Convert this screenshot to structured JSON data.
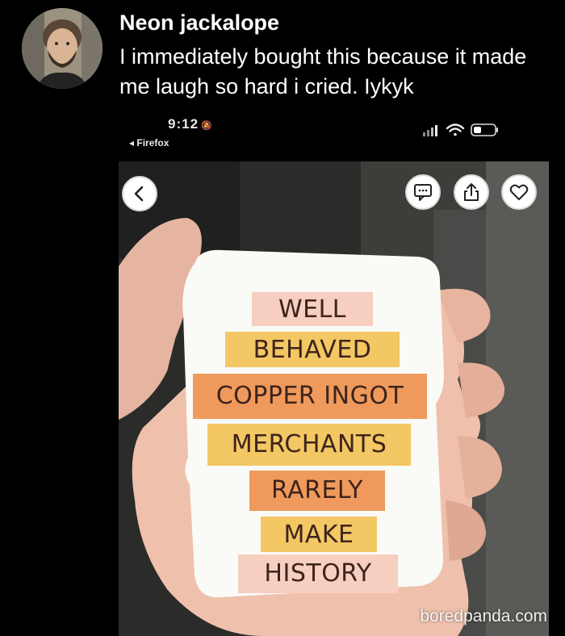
{
  "post": {
    "author_name": "Neon jackalope",
    "text": "I immediately bought this because it made me laugh so hard i cried. Iykyk"
  },
  "embedded": {
    "status_time": "9:12",
    "back_app_label": "◂ Firefox",
    "sticker_lines": [
      "WELL",
      "BEHAVED",
      "COPPER INGOT",
      "MERCHANTS",
      "RARELY",
      "MAKE",
      "HISTORY"
    ]
  },
  "watermark": "boredpanda.com",
  "colors": {
    "background": "#000000",
    "sticker_band_pink": "#f6cfc0",
    "sticker_band_yellow": "#f3c763",
    "sticker_band_orange": "#ef9a5c",
    "sticker_text": "#3e241b"
  },
  "icons": [
    "avatar",
    "bell-muted-icon",
    "signal-icon",
    "wifi-icon",
    "battery-icon",
    "back-chevron-icon",
    "comment-icon",
    "share-icon",
    "heart-icon"
  ]
}
